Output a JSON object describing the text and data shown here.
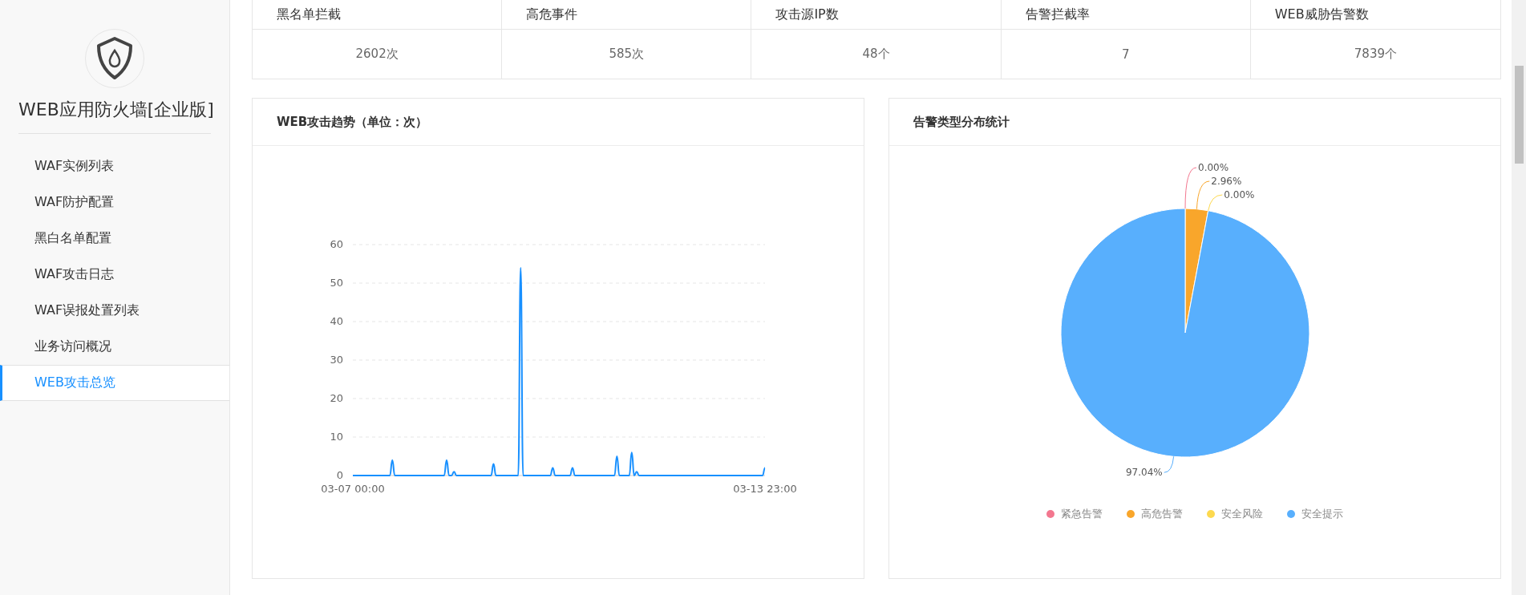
{
  "sidebar": {
    "title": "WEB应用防火墙[企业版]",
    "items": [
      {
        "label": "WAF实例列表",
        "selected": false
      },
      {
        "label": "WAF防护配置",
        "selected": false
      },
      {
        "label": "黑白名单配置",
        "selected": false
      },
      {
        "label": "WAF攻击日志",
        "selected": false
      },
      {
        "label": "WAF误报处置列表",
        "selected": false
      },
      {
        "label": "业务访问概况",
        "selected": false
      },
      {
        "label": "WEB攻击总览",
        "selected": true
      }
    ]
  },
  "summary_table": {
    "columns": [
      "黑名单拦截",
      "高危事件",
      "攻击源IP数",
      "告警拦截率",
      "WEB威胁告警数"
    ],
    "values": [
      "2602次",
      "585次",
      "48个",
      "7",
      "7839个"
    ]
  },
  "attack_trend": {
    "title": "WEB攻击趋势（单位：次）",
    "chart_data": {
      "type": "line",
      "ylim": [
        0,
        60
      ],
      "yticks": [
        0,
        10,
        20,
        30,
        40,
        50,
        60
      ],
      "grid": true,
      "categories": [
        "03-07 00:00",
        null,
        null,
        null,
        null,
        null,
        null,
        null,
        null,
        null,
        null,
        null,
        null,
        null,
        null,
        null,
        null,
        null,
        null,
        null,
        null,
        null,
        null,
        null,
        null,
        null,
        null,
        null,
        null,
        null,
        null,
        null,
        null,
        null,
        null,
        null,
        null,
        null,
        null,
        null,
        null,
        null,
        null,
        null,
        null,
        null,
        null,
        null,
        null,
        null,
        null,
        null,
        null,
        null,
        null,
        null,
        null,
        null,
        null,
        null,
        null,
        null,
        null,
        null,
        null,
        null,
        null,
        null,
        null,
        null,
        null,
        null,
        null,
        null,
        null,
        null,
        null,
        null,
        null,
        null,
        null,
        null,
        null,
        null,
        null,
        null,
        null,
        null,
        null,
        null,
        null,
        null,
        null,
        null,
        null,
        null,
        null,
        null,
        null,
        null,
        null,
        null,
        null,
        null,
        null,
        null,
        null,
        null,
        null,
        null,
        null,
        null,
        null,
        null,
        null,
        null,
        null,
        null,
        null,
        null,
        null,
        null,
        null,
        null,
        null,
        null,
        null,
        null,
        null,
        null,
        null,
        null,
        null,
        null,
        null,
        null,
        null,
        null,
        null,
        null,
        null,
        null,
        null,
        null,
        null,
        null,
        null,
        null,
        null,
        null,
        null,
        null,
        null,
        null,
        null,
        null,
        null,
        null,
        null,
        null,
        null,
        null,
        null,
        null,
        null,
        null,
        null,
        "03-13 23:00"
      ],
      "series": [
        {
          "color": "#1890ff",
          "values": [
            0,
            0,
            0,
            0,
            0,
            0,
            0,
            0,
            0,
            0,
            0,
            0,
            0,
            0,
            0,
            0,
            4,
            0,
            0,
            0,
            0,
            0,
            0,
            0,
            0,
            0,
            0,
            0,
            0,
            0,
            0,
            0,
            0,
            0,
            0,
            0,
            0,
            0,
            4,
            0,
            0,
            1,
            0,
            0,
            0,
            0,
            0,
            0,
            0,
            0,
            0,
            0,
            0,
            0,
            0,
            0,
            0,
            3,
            0,
            0,
            0,
            0,
            0,
            0,
            0,
            0,
            0,
            0,
            54,
            0,
            0,
            0,
            0,
            0,
            0,
            0,
            0,
            0,
            0,
            0,
            0,
            2,
            0,
            0,
            0,
            0,
            0,
            0,
            0,
            2,
            0,
            0,
            0,
            0,
            0,
            0,
            0,
            0,
            0,
            0,
            0,
            0,
            0,
            0,
            0,
            0,
            0,
            5,
            0,
            0,
            0,
            0,
            0,
            6,
            0,
            1,
            0,
            0,
            0,
            0,
            0,
            0,
            0,
            0,
            0,
            0,
            0,
            0,
            0,
            0,
            0,
            0,
            0,
            0,
            0,
            0,
            0,
            0,
            0,
            0,
            0,
            0,
            0,
            0,
            0,
            0,
            0,
            0,
            0,
            0,
            0,
            0,
            0,
            0,
            0,
            0,
            0,
            0,
            0,
            0,
            0,
            0,
            0,
            0,
            0,
            0,
            0,
            2
          ]
        }
      ]
    }
  },
  "alert_distribution": {
    "title": "告警类型分布统计",
    "chart_data": {
      "type": "pie",
      "categories": [
        "紧急告警",
        "高危告警",
        "安全风险",
        "安全提示"
      ],
      "values": [
        0,
        2.96,
        0,
        97.04
      ],
      "value_labels": [
        "0.00%",
        "2.96%",
        "0.00%",
        "97.04%"
      ],
      "colors": [
        "#f3778f",
        "#f9a62b",
        "#fdd94f",
        "#58affd"
      ]
    }
  }
}
